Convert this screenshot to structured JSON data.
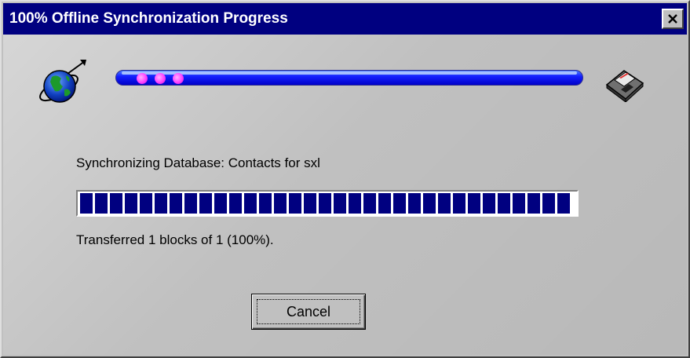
{
  "window": {
    "title": "100% Offline Synchronization Progress",
    "close_glyph": "×"
  },
  "icons": {
    "left": "globe-icon",
    "right": "floppy-disk-icon"
  },
  "sync_animation": {
    "dot_count": 3,
    "bar_color": "#0a1fff",
    "dot_color": "#ff40ff"
  },
  "status": {
    "database_text": "Synchronizing Database: Contacts for sxl",
    "transfer_text": "Transferred 1 blocks of 1 (100%).",
    "progress_percent": 100
  },
  "buttons": {
    "cancel_label": "Cancel"
  },
  "colors": {
    "title_bar": "#000080",
    "progress_fill": "#000080",
    "face": "#c0c0c0"
  }
}
